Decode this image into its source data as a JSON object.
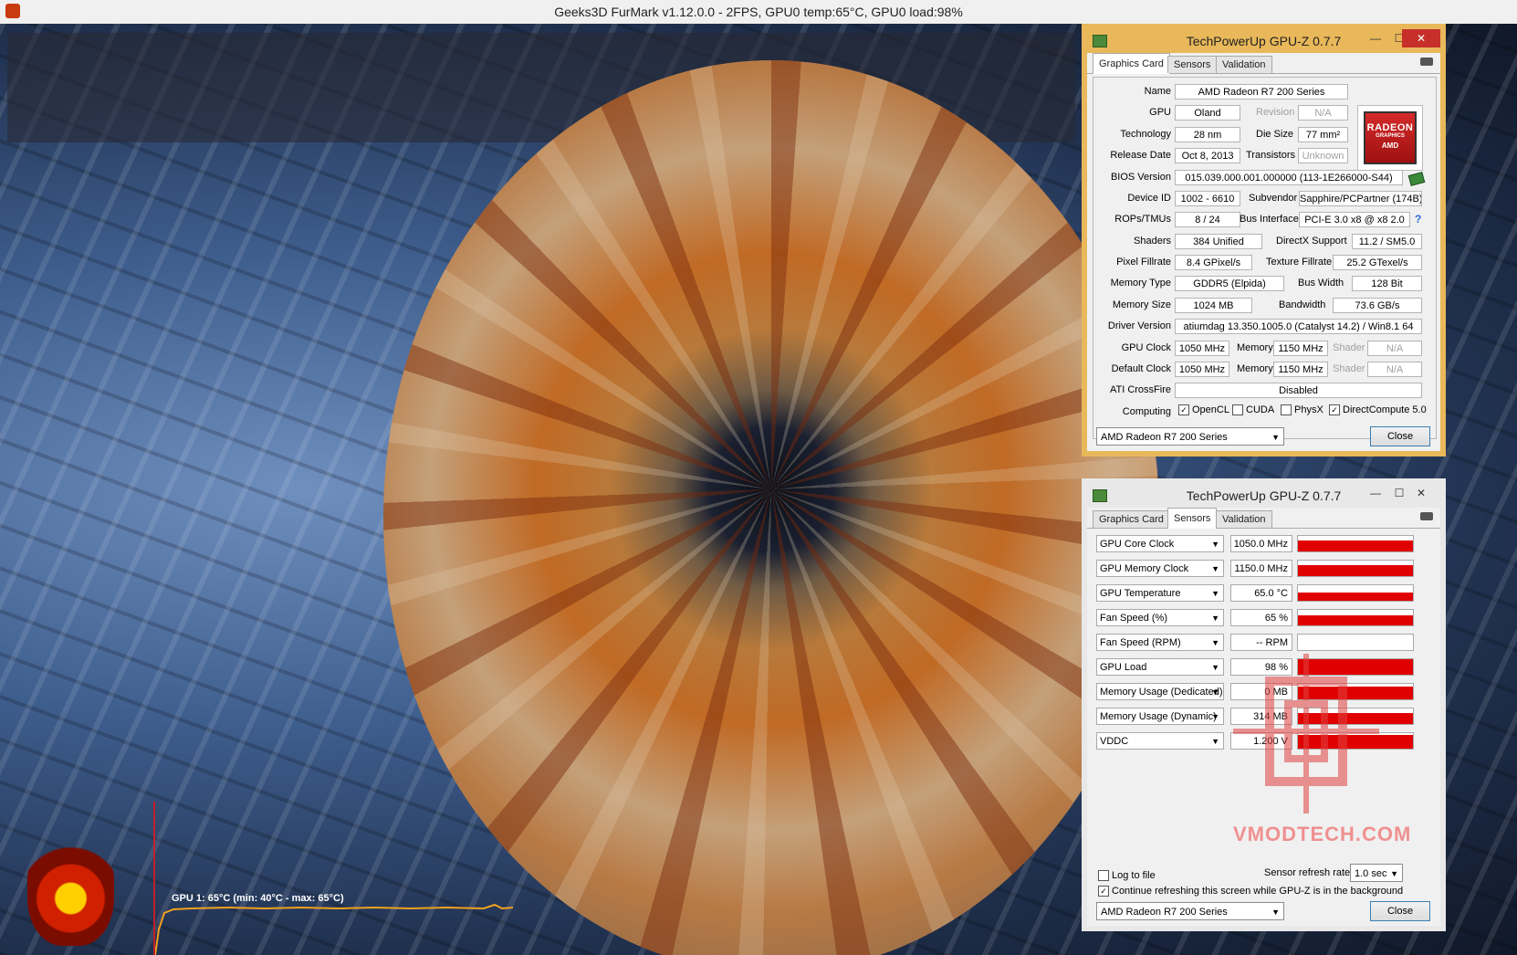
{
  "furmark": {
    "title": "Geeks3D FurMark v1.12.0.0 - 2FPS, GPU0 temp:65°C, GPU0 load:98%",
    "graph_label": "GPU 1: 65°C (min: 40°C - max: 65°C)"
  },
  "gpuz_main": {
    "title": "TechPowerUp GPU-Z 0.7.7",
    "window_buttons": {
      "minimize": "—",
      "maximize": "☐",
      "close": "✕"
    },
    "tabs": [
      "Graphics Card",
      "Sensors",
      "Validation"
    ],
    "active_tab": "Graphics Card",
    "logo": {
      "line1": "RADEON",
      "line2": "GRAPHICS",
      "line3": "AMD"
    },
    "fields": {
      "name_label": "Name",
      "name": "AMD Radeon R7 200 Series",
      "gpu_label": "GPU",
      "gpu": "Oland",
      "revision_label": "Revision",
      "revision": "N/A",
      "technology_label": "Technology",
      "technology": "28 nm",
      "die_size_label": "Die Size",
      "die_size": "77 mm²",
      "release_date_label": "Release Date",
      "release_date": "Oct 8, 2013",
      "transistors_label": "Transistors",
      "transistors": "Unknown",
      "bios_label": "BIOS Version",
      "bios": "015.039.000.001.000000 (113-1E266000-S44)",
      "device_id_label": "Device ID",
      "device_id": "1002 - 6610",
      "subvendor_label": "Subvendor",
      "subvendor": "Sapphire/PCPartner (174B)",
      "rops_label": "ROPs/TMUs",
      "rops": "8 / 24",
      "bus_label": "Bus Interface",
      "bus": "PCI-E 3.0 x8 @ x8 2.0",
      "bus_help": "?",
      "shaders_label": "Shaders",
      "shaders": "384 Unified",
      "directx_label": "DirectX Support",
      "directx": "11.2 / SM5.0",
      "pixel_label": "Pixel Fillrate",
      "pixel": "8.4 GPixel/s",
      "texture_label": "Texture Fillrate",
      "texture": "25.2 GTexel/s",
      "memtype_label": "Memory Type",
      "memtype": "GDDR5 (Elpida)",
      "buswidth_label": "Bus Width",
      "buswidth": "128 Bit",
      "memsize_label": "Memory Size",
      "memsize": "1024 MB",
      "bandwidth_label": "Bandwidth",
      "bandwidth": "73.6 GB/s",
      "driver_label": "Driver Version",
      "driver": "atiumdag 13.350.1005.0 (Catalyst 14.2) / Win8.1 64",
      "gpuclock_label": "GPU Clock",
      "gpuclock": "1050 MHz",
      "memory_label": "Memory",
      "memclock": "1150 MHz",
      "shader_label": "Shader",
      "shader": "N/A",
      "defclock_label": "Default Clock",
      "defclock": "1050 MHz",
      "defmem": "1150 MHz",
      "defshader": "N/A",
      "crossfire_label": "ATI CrossFire",
      "crossfire": "Disabled",
      "computing_label": "Computing"
    },
    "computing": [
      {
        "label": "OpenCL",
        "checked": true
      },
      {
        "label": "CUDA",
        "checked": false
      },
      {
        "label": "PhysX",
        "checked": false
      },
      {
        "label": "DirectCompute 5.0",
        "checked": true
      }
    ],
    "device_select": "AMD Radeon R7 200 Series",
    "close_label": "Close"
  },
  "gpuz_sensors": {
    "title": "TechPowerUp GPU-Z 0.7.7",
    "window_buttons": {
      "minimize": "—",
      "maximize": "☐",
      "close": "✕"
    },
    "tabs": [
      "Graphics Card",
      "Sensors",
      "Validation"
    ],
    "active_tab": "Sensors",
    "sensors": [
      {
        "name": "GPU Core Clock",
        "value": "1050.0 MHz",
        "level": 0.7
      },
      {
        "name": "GPU Memory Clock",
        "value": "1150.0 MHz",
        "level": 0.7
      },
      {
        "name": "GPU Temperature",
        "value": "65.0 °C",
        "level": 0.55
      },
      {
        "name": "Fan Speed (%)",
        "value": "65 %",
        "level": 0.65
      },
      {
        "name": "Fan Speed (RPM)",
        "value": "-- RPM",
        "level": 0.0
      },
      {
        "name": "GPU Load",
        "value": "98 %",
        "level": 0.98
      },
      {
        "name": "Memory Usage (Dedicated)",
        "value": "0 MB",
        "level": 0.8
      },
      {
        "name": "Memory Usage (Dynamic)",
        "value": "314 MB",
        "level": 0.7
      },
      {
        "name": "VDDC",
        "value": "1.200 V",
        "level": 0.9
      }
    ],
    "log_to_file_label": "Log to file",
    "log_to_file": false,
    "refresh_rate_label": "Sensor refresh rate:",
    "refresh_rate": "1.0 sec",
    "continue_refresh_label": "Continue refreshing this screen while GPU-Z is in the background",
    "continue_refresh": true,
    "device_select": "AMD Radeon R7 200 Series",
    "close_label": "Close",
    "watermark": "VMODTECH.COM"
  }
}
